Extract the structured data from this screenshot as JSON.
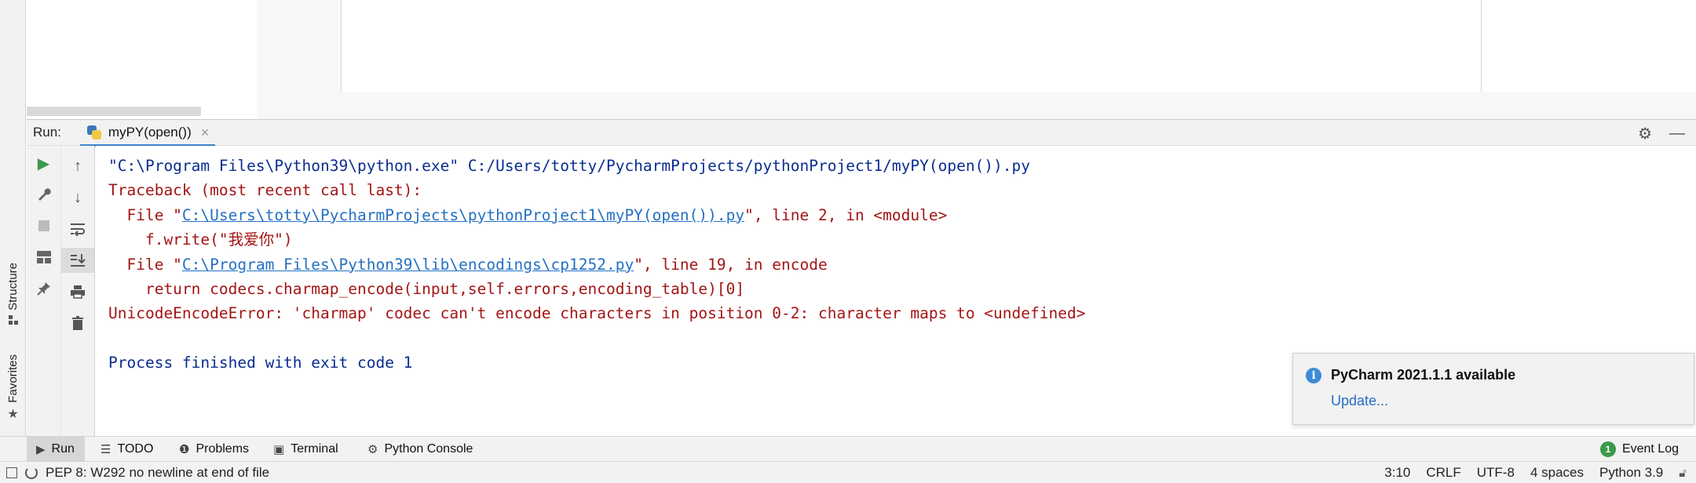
{
  "left_strip": {
    "structure_label": "Structure",
    "favorites_label": "Favorites"
  },
  "run_window": {
    "label": "Run:",
    "tab_name": "myPY(open())",
    "tab_close": "×"
  },
  "console": {
    "lines": [
      {
        "segments": [
          {
            "text": "\"C:\\Program Files\\Python39\\python.exe\" C:/Users/totty/PycharmProjects/pythonProject1/myPY(open()).py",
            "style": "blue"
          }
        ]
      },
      {
        "segments": [
          {
            "text": "Traceback (most recent call last):",
            "style": "red"
          }
        ]
      },
      {
        "segments": [
          {
            "text": "  File \"",
            "style": "red"
          },
          {
            "text": "C:\\Users\\totty\\PycharmProjects\\pythonProject1\\myPY(open()).py",
            "style": "link"
          },
          {
            "text": "\", line 2, in <module>",
            "style": "red"
          }
        ]
      },
      {
        "segments": [
          {
            "text": "    f.write(\"我爱你\")",
            "style": "red"
          }
        ]
      },
      {
        "segments": [
          {
            "text": "  File \"",
            "style": "red"
          },
          {
            "text": "C:\\Program Files\\Python39\\lib\\encodings\\cp1252.py",
            "style": "link"
          },
          {
            "text": "\", line 19, in encode",
            "style": "red"
          }
        ]
      },
      {
        "segments": [
          {
            "text": "    return codecs.charmap_encode(input,self.errors,encoding_table)[0]",
            "style": "red"
          }
        ]
      },
      {
        "segments": [
          {
            "text": "UnicodeEncodeError: 'charmap' codec can't encode characters in position 0-2: character maps to <undefined>",
            "style": "red"
          }
        ]
      },
      {
        "segments": [
          {
            "text": "",
            "style": "blue"
          }
        ]
      },
      {
        "segments": [
          {
            "text": "Process finished with exit code 1",
            "style": "blue"
          }
        ]
      }
    ]
  },
  "notification": {
    "title": "PyCharm 2021.1.1 available",
    "link": "Update...",
    "icon": "info-icon"
  },
  "tool_window_bar": {
    "run": "Run",
    "todo": "TODO",
    "problems": "Problems",
    "terminal": "Terminal",
    "python_console": "Python Console",
    "event_log": "Event Log",
    "event_log_count": "1"
  },
  "status_bar": {
    "message": "PEP 8: W292 no newline at end of file",
    "position": "3:10",
    "line_separator": "CRLF",
    "encoding": "UTF-8",
    "indent": "4 spaces",
    "interpreter": "Python 3.9"
  },
  "colors": {
    "console_blue": "#0a2d8f",
    "console_red": "#a31515",
    "link": "#2470c4",
    "run_green": "#3c9a4b",
    "accent": "#4083c9"
  }
}
